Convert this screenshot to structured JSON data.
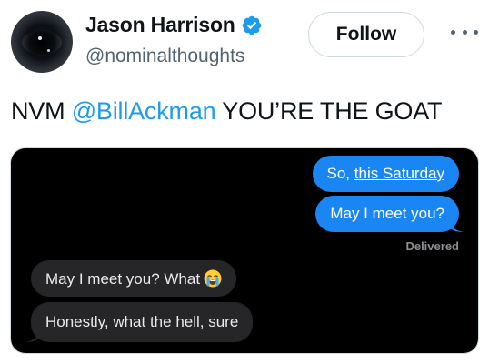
{
  "author": {
    "display_name": "Jason Harrison",
    "handle": "@nominalthoughts",
    "verified": true,
    "verified_color": "#1d9bf0"
  },
  "actions": {
    "follow_label": "Follow",
    "more_icon": "more-dots-icon"
  },
  "tweet": {
    "text_before": "NVM ",
    "mention": "@BillAckman",
    "text_after": " YOU’RE THE GOAT",
    "mention_color": "#1d9bf0"
  },
  "media": {
    "messages": [
      {
        "from": "me",
        "text_before": "So, ",
        "link": "this Saturday"
      },
      {
        "from": "me",
        "text": "May I meet you?"
      },
      {
        "from": "them",
        "text": "May I meet you? What",
        "emoji": "crying-face-emoji"
      },
      {
        "from": "them",
        "text": "Honestly, what the hell, sure"
      }
    ],
    "status": "Delivered",
    "sent_color": "#1a86f3",
    "received_color": "#262628"
  }
}
